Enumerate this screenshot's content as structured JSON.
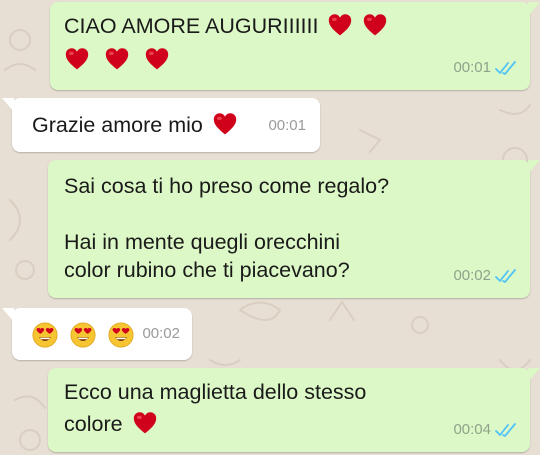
{
  "colors": {
    "outgoing_bubble": "#dcf8c6",
    "incoming_bubble": "#ffffff",
    "chat_background": "#e7dfd4",
    "read_ticks": "#4fc3f7",
    "heart": "#d0021b"
  },
  "messages": [
    {
      "direction": "outgoing",
      "lines": [
        "CIAO AMORE AUGURIIIIII"
      ],
      "emoji_line1": [
        "red-heart",
        "red-heart"
      ],
      "emoji_line2": [
        "red-heart",
        "red-heart",
        "red-heart"
      ],
      "time": "00:01",
      "status_icon": "double-check-read-icon"
    },
    {
      "direction": "incoming",
      "text": "Grazie amore mio",
      "emoji": [
        "red-heart"
      ],
      "time": "00:01"
    },
    {
      "direction": "outgoing",
      "lines": [
        "Sai cosa ti ho preso come regalo?",
        "Hai in mente quegli orecchini",
        "color rubino che ti piacevano?"
      ],
      "time": "00:02",
      "status_icon": "double-check-read-icon"
    },
    {
      "direction": "incoming",
      "emoji": [
        "heart-eyes-face",
        "heart-eyes-face",
        "heart-eyes-face"
      ],
      "time": "00:02"
    },
    {
      "direction": "outgoing",
      "lines": [
        "Ecco una maglietta dello stesso",
        "colore"
      ],
      "emoji": [
        "red-heart"
      ],
      "time": "00:04",
      "status_icon": "double-check-read-icon"
    }
  ]
}
